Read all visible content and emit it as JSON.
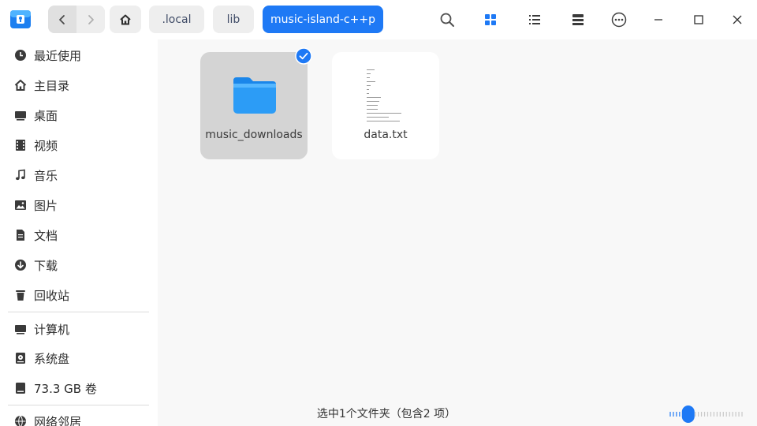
{
  "titlebar": {
    "breadcrumbs": [
      ".local",
      "lib",
      "music-island-c++p"
    ]
  },
  "sidebar": {
    "items": [
      {
        "label": "最近使用",
        "icon": "clock-icon"
      },
      {
        "label": "主目录",
        "icon": "home-icon"
      },
      {
        "label": "桌面",
        "icon": "desktop-icon"
      },
      {
        "label": "视频",
        "icon": "video-icon"
      },
      {
        "label": "音乐",
        "icon": "music-note-icon"
      },
      {
        "label": "图片",
        "icon": "image-icon"
      },
      {
        "label": "文档",
        "icon": "document-icon"
      },
      {
        "label": "下载",
        "icon": "download-icon"
      },
      {
        "label": "回收站",
        "icon": "trash-icon"
      }
    ],
    "devices": [
      {
        "label": "计算机",
        "icon": "computer-icon"
      },
      {
        "label": "系统盘",
        "icon": "system-disk-icon"
      },
      {
        "label": "73.3 GB 卷",
        "icon": "drive-icon"
      }
    ],
    "network": [
      {
        "label": "网络邻居",
        "icon": "network-icon"
      }
    ]
  },
  "files": [
    {
      "name": "music_downloads",
      "type": "folder",
      "selected": true
    },
    {
      "name": "data.txt",
      "type": "text",
      "selected": false
    }
  ],
  "status": {
    "text": "选中1个文件夹（包含2 项）"
  },
  "zoom": {
    "level_fraction": 0.25
  },
  "colors": {
    "accent": "#1e79f5",
    "folder": "#2c9cf6",
    "selected_tile": "#d4d4d4"
  }
}
